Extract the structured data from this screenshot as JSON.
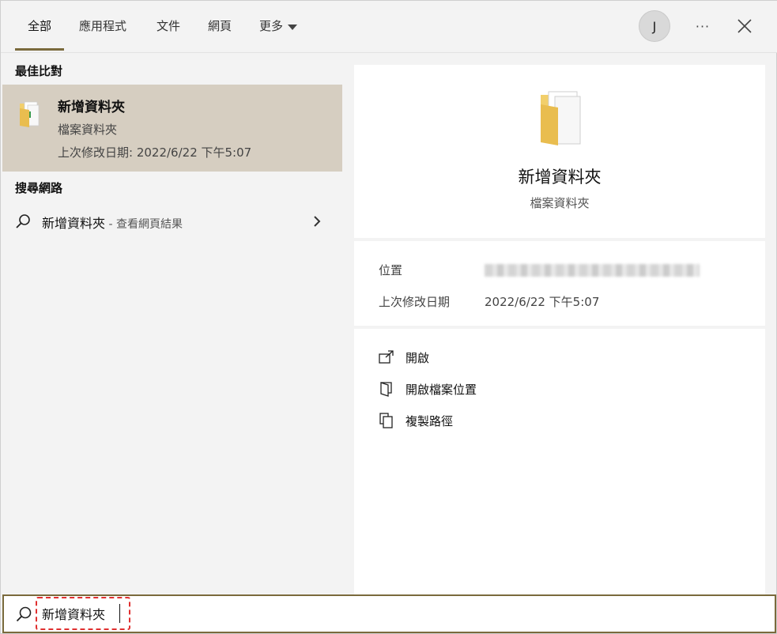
{
  "tabs": [
    {
      "label": "全部",
      "active": true
    },
    {
      "label": "應用程式"
    },
    {
      "label": "文件"
    },
    {
      "label": "網頁"
    },
    {
      "label": "更多"
    }
  ],
  "account": {
    "initial": "J"
  },
  "more_options_label": "···",
  "left": {
    "best_match_title": "最佳比對",
    "best_match": {
      "name": "新增資料夾",
      "type": "檔案資料夾",
      "modified": "上次修改日期: 2022/6/22 下午5:07"
    },
    "web_title": "搜尋網路",
    "web_result": {
      "query": "新增資料夾",
      "suffix": " - 查看網頁結果"
    }
  },
  "preview": {
    "name": "新增資料夾",
    "type": "檔案資料夾",
    "location_label": "位置",
    "modified_label": "上次修改日期",
    "modified_value": "2022/6/22 下午5:07",
    "actions": [
      {
        "label": "開啟",
        "icon": "open-icon"
      },
      {
        "label": "開啟檔案位置",
        "icon": "folder-location-icon"
      },
      {
        "label": "複製路徑",
        "icon": "copy-icon"
      }
    ]
  },
  "search": {
    "value": "新增資料夾"
  },
  "colors": {
    "accent": "#7a6a3c",
    "selected_bg": "#d6cec1",
    "highlight_box": "#e03030"
  }
}
